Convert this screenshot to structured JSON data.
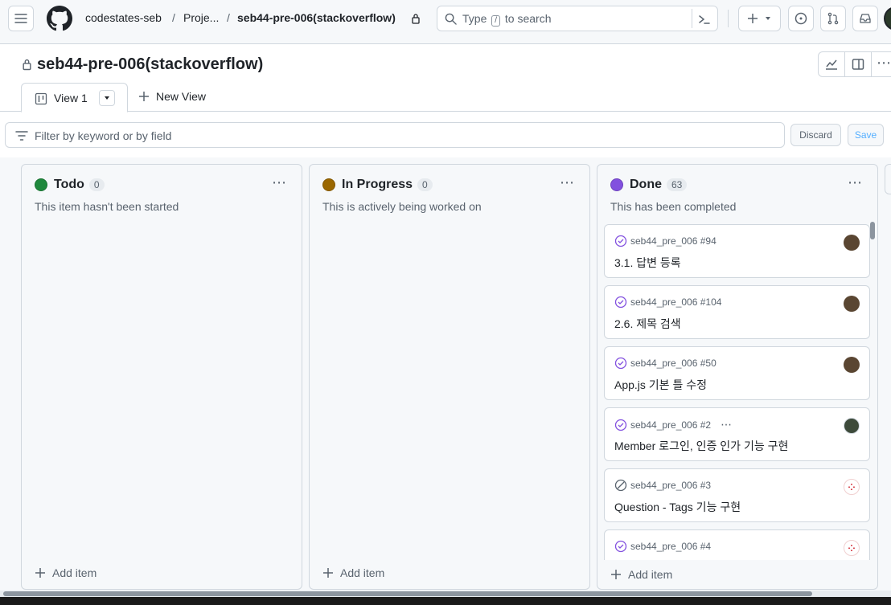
{
  "header": {
    "org": "codestates-seb",
    "sep1": "/",
    "projects": "Proje...",
    "sep2": "/",
    "project": "seb44-pre-006(stackoverflow)",
    "search_type": "Type",
    "search_key": "/",
    "search_rest": "to search"
  },
  "project": {
    "title": "seb44-pre-006(stackoverflow)"
  },
  "views": {
    "active_label": "View 1",
    "new_view_label": "New View"
  },
  "filter": {
    "placeholder": "Filter by keyword or by field",
    "discard_label": "Discard",
    "save_label": "Save"
  },
  "columns": [
    {
      "name": "Todo",
      "count": "0",
      "description": "This item hasn't been started",
      "color": "#1f883d",
      "add_label": "Add item"
    },
    {
      "name": "In Progress",
      "count": "0",
      "description": "This is actively being worked on",
      "color": "#9a6700",
      "add_label": "Add item"
    },
    {
      "name": "Done",
      "count": "63",
      "description": "This has been completed",
      "color": "#8250df",
      "add_label": "Add item"
    }
  ],
  "done_cards": [
    {
      "ref": "seb44_pre_006 #94",
      "title": "3.1. 답변 등록",
      "status": "done",
      "avatar": "#5a4632"
    },
    {
      "ref": "seb44_pre_006 #104",
      "title": "2.6. 제목 검색",
      "status": "done",
      "avatar": "#5a4632"
    },
    {
      "ref": "seb44_pre_006 #50",
      "title": "App.js 기본 틀 수정",
      "status": "done",
      "avatar": "#5a4632"
    },
    {
      "ref": "seb44_pre_006 #2",
      "title": "Member 로그인, 인증 인가 기능 구현",
      "status": "done",
      "avatar": "#3d4a3a"
    },
    {
      "ref": "seb44_pre_006 #3",
      "title": "Question - Tags 기능 구현",
      "status": "not-planned",
      "avatar": "#ffffff"
    },
    {
      "ref": "seb44_pre_006 #4",
      "title": "",
      "status": "done",
      "avatar": "#ffffff"
    }
  ],
  "colors": {
    "accent_done": "#8250df",
    "border": "#d0d7de",
    "muted": "#59636e"
  }
}
